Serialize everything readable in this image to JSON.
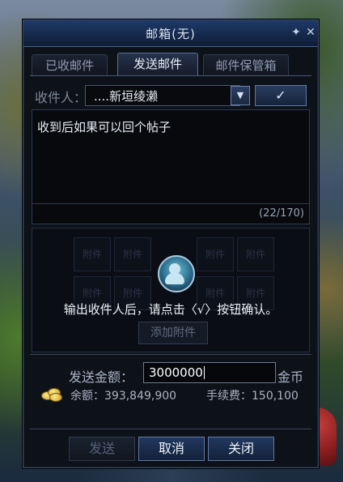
{
  "window": {
    "title": "邮箱(无)",
    "pin_glyph": "✦",
    "close_glyph": "✕"
  },
  "tabs": [
    {
      "label": "已收邮件",
      "active": false
    },
    {
      "label": "发送邮件",
      "active": true
    },
    {
      "label": "邮件保管箱",
      "active": false
    }
  ],
  "recipient": {
    "label": "收件人：",
    "value": "....新垣绫濑",
    "dropdown_glyph": "▼",
    "confirm_glyph": "✓"
  },
  "message": {
    "text": "收到后如果可以回个帖子",
    "char_count": "(22/170)"
  },
  "attachments": {
    "slot_label": "附件",
    "instruction": "输出收件人后，请点击〈√〉按钮确认。",
    "add_button": "添加附件"
  },
  "money": {
    "send_label": "发送金额：",
    "send_value": "3000000",
    "currency_label": "金币",
    "balance_label": "余额：393,849,900",
    "fee_label": "手续费：150,100"
  },
  "buttons": {
    "send": "发送",
    "cancel": "取消",
    "close": "关闭"
  }
}
